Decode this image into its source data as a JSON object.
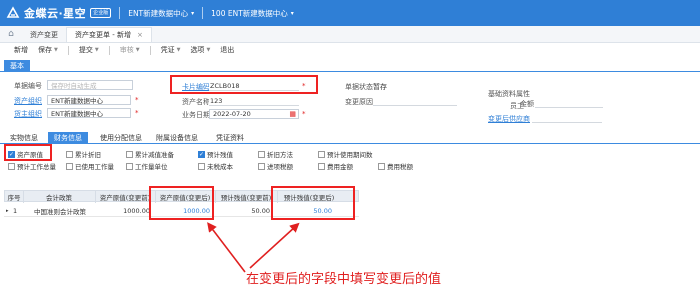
{
  "topbar": {
    "logo_text": "金蝶云·星空",
    "logo_badge": "企业版",
    "org": "ENT新建数据中心",
    "datacenter": "100  ENT新建数据中心"
  },
  "tabs": [
    {
      "label": "资产变更"
    },
    {
      "label": "资产变更单 - 新增",
      "close": "×"
    }
  ],
  "toolbar": {
    "items": [
      {
        "label": "新增"
      },
      {
        "label": "保存",
        "caret": "▼"
      },
      {
        "label": "提交",
        "caret": "▼"
      },
      {
        "label": "审核",
        "caret": "▼"
      },
      {
        "label": "凭证",
        "caret": "▼"
      },
      {
        "label": "选项",
        "caret": "▼"
      },
      {
        "label": "退出"
      }
    ]
  },
  "basic_tab": "基本",
  "form": {
    "bill_no_label": "单据编号",
    "bill_no_placeholder": "保存时自动生成",
    "asset_org_label": "资产组织",
    "asset_org_value": "ENT新建数据中心",
    "cargo_org_label": "货主组织",
    "cargo_org_value": "ENT新建数据中心",
    "card_code_label": "卡片编码",
    "card_code_value": "ZCLB018",
    "asset_name_label": "资产名称",
    "asset_name_value": "123",
    "biz_date_label": "业务日期",
    "biz_date_value": "2022-07-20",
    "status_label": "单据状态",
    "status_value": "暂存",
    "change_reason_label": "变更原因",
    "base_attr_label": "基础资料属性",
    "employee_label": "员工",
    "amount_label": "金额",
    "change_after_supplier_label": "变更后供应商"
  },
  "subtabs": [
    {
      "label": "实物信息"
    },
    {
      "label": "财务信息"
    },
    {
      "label": "使用分配信息"
    },
    {
      "label": "附属设备信息"
    },
    {
      "label": "凭证资料"
    }
  ],
  "checkboxes": [
    {
      "label": "资产原值",
      "checked": true
    },
    {
      "label": "累计折旧",
      "checked": false
    },
    {
      "label": "累计减值准备",
      "checked": false
    },
    {
      "label": "预计残值",
      "checked": true
    },
    {
      "label": "折旧方法",
      "checked": false
    },
    {
      "label": "预计使用期间数",
      "checked": false
    },
    {
      "label": "预计工作总量",
      "checked": false
    },
    {
      "label": "已使用工作量",
      "checked": false
    },
    {
      "label": "工作量单位",
      "checked": false
    },
    {
      "label": "未税成本",
      "checked": false
    },
    {
      "label": "进项税额",
      "checked": false
    },
    {
      "label": "费用金额",
      "checked": false
    },
    {
      "label": "费用税额",
      "checked": false
    }
  ],
  "grid": {
    "headers": [
      "序号",
      "会计政策",
      "资产原值(变更前)",
      "资产原值(变更后)",
      "预计残值(变更前)",
      "预计残值(变更后)"
    ],
    "row": {
      "marker": "▸",
      "seq": "1",
      "policy": "中国准则会计政策",
      "orig_before": "1000.00",
      "orig_after": "1000.00",
      "residual_before": "50.00",
      "residual_after": "50.00"
    }
  },
  "annotation": "在变更后的字段中填写变更后的值",
  "colors": {
    "brand": "#2f7fd6",
    "highlight": "#e22222"
  }
}
